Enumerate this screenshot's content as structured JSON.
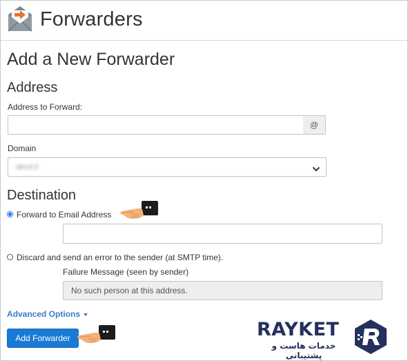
{
  "header": {
    "title": "Forwarders",
    "icon": "email-forward-icon"
  },
  "section_title": "Add a New Forwarder",
  "address": {
    "heading": "Address",
    "forward_label": "Address to Forward:",
    "forward_value": "",
    "at_symbol": "@",
    "domain_label": "Domain",
    "domain_value": "abcd.ir"
  },
  "destination": {
    "heading": "Destination",
    "option_forward": {
      "label": "Forward to Email Address",
      "selected": true,
      "value": ""
    },
    "option_discard": {
      "label": "Discard and send an error to the sender (at SMTP time).",
      "selected": false
    },
    "failure_label": "Failure Message (seen by sender)",
    "failure_value": "No such person at this address."
  },
  "advanced_options": "Advanced Options",
  "submit_button": "Add Forwarder",
  "watermark": {
    "name": "RAYKET",
    "tagline": "خدمات هاست و پشتیبانی"
  },
  "colors": {
    "primary": "#1a7ad6",
    "link": "#3a7bc8",
    "brand": "#24305e",
    "icon_accent": "#e8732c"
  }
}
